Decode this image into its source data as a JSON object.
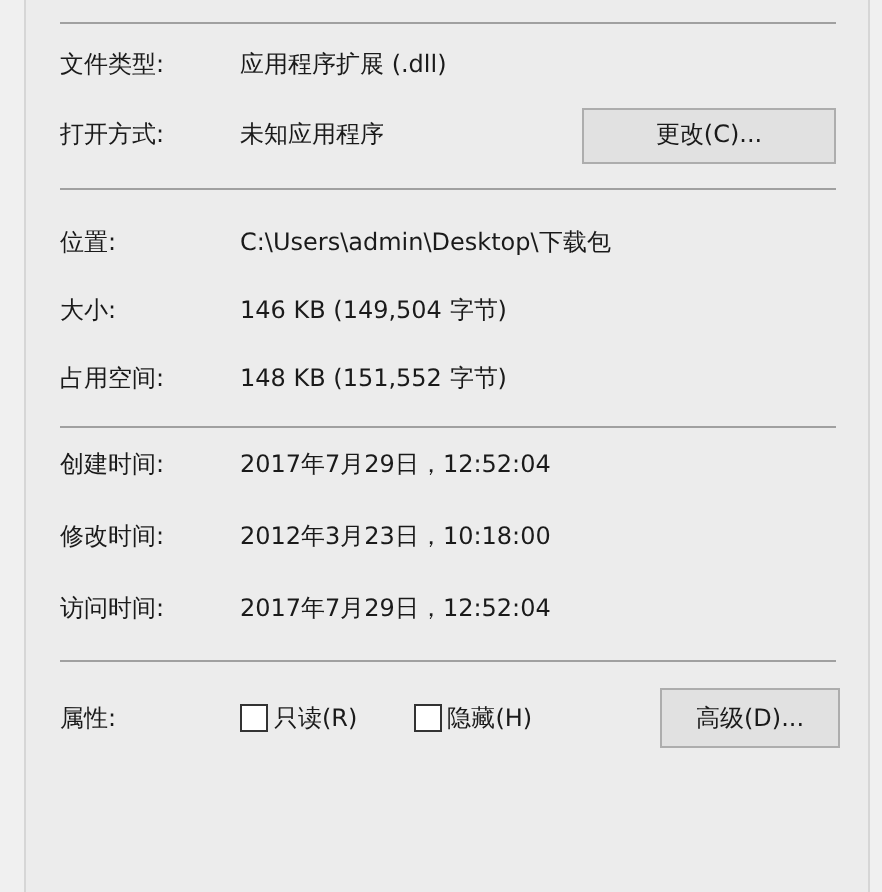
{
  "sections": [
    {
      "rows": [
        {
          "label": "文件类型:",
          "value": "应用程序扩展 (.dll)"
        },
        {
          "label": "打开方式:",
          "value": "未知应用程序",
          "button": "更改(C)..."
        }
      ]
    },
    {
      "rows": [
        {
          "label": "位置:",
          "value": "C:\\Users\\admin\\Desktop\\下载包"
        },
        {
          "label": "大小:",
          "value": "146 KB (149,504 字节)"
        },
        {
          "label": "占用空间:",
          "value": "148 KB (151,552 字节)"
        }
      ]
    },
    {
      "rows": [
        {
          "label": "创建时间:",
          "value": "2017年7月29日，12:52:04"
        },
        {
          "label": "修改时间:",
          "value": "2012年3月23日，10:18:00"
        },
        {
          "label": "访问时间:",
          "value": "2017年7月29日，12:52:04"
        }
      ]
    }
  ],
  "attributes": {
    "label": "属性:",
    "checkboxes": [
      {
        "label": "只读(R)",
        "checked": false
      },
      {
        "label": "隐藏(H)",
        "checked": false
      }
    ],
    "button": "高级(D)..."
  }
}
